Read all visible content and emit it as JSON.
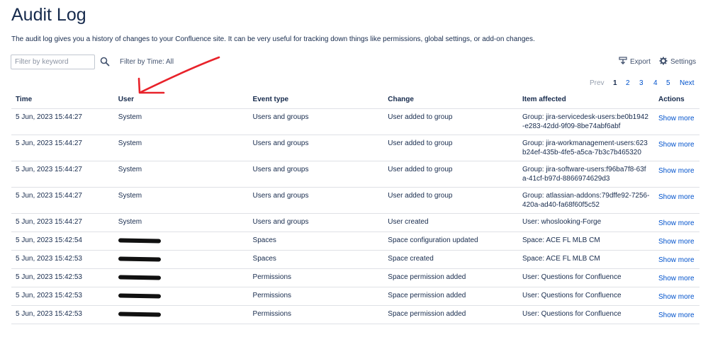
{
  "page": {
    "title": "Audit Log",
    "description": "The audit log gives you a history of changes to your Confluence site. It can be very useful for tracking down things like permissions, global settings, or add-on changes."
  },
  "filters": {
    "keyword_placeholder": "Filter by keyword",
    "keyword_value": "",
    "time_label": "Filter by Time: All"
  },
  "toolbar": {
    "export_label": "Export",
    "settings_label": "Settings"
  },
  "pagination": {
    "prev": "Prev",
    "pages": [
      "1",
      "2",
      "3",
      "4",
      "5"
    ],
    "current": "1",
    "next": "Next"
  },
  "table": {
    "headers": [
      "Time",
      "User",
      "Event type",
      "Change",
      "Item affected",
      "Actions"
    ],
    "rows": [
      {
        "time": "5 Jun, 2023 15:44:27",
        "user": "System",
        "event": "Users and groups",
        "change": "User added to group",
        "item": "Group: jira-servicedesk-users:be0b1942-e283-42dd-9f09-8be74abf6abf",
        "action": "Show more"
      },
      {
        "time": "5 Jun, 2023 15:44:27",
        "user": "System",
        "event": "Users and groups",
        "change": "User added to group",
        "item": "Group: jira-workmanagement-users:623b24ef-435b-4fe5-a5ca-7b3c7b465320",
        "action": "Show more"
      },
      {
        "time": "5 Jun, 2023 15:44:27",
        "user": "System",
        "event": "Users and groups",
        "change": "User added to group",
        "item": "Group: jira-software-users:f96ba7f8-63fa-41cf-b97d-8866974629d3",
        "action": "Show more"
      },
      {
        "time": "5 Jun, 2023 15:44:27",
        "user": "System",
        "event": "Users and groups",
        "change": "User added to group",
        "item": "Group: atlassian-addons:79dffe92-7256-420a-ad40-fa68f60f5c52",
        "action": "Show more"
      },
      {
        "time": "5 Jun, 2023 15:44:27",
        "user": "System",
        "event": "Users and groups",
        "change": "User created",
        "item": "User: whoslooking-Forge",
        "action": "Show more"
      },
      {
        "time": "5 Jun, 2023 15:42:54",
        "user": "",
        "event": "Spaces",
        "change": "Space configuration updated",
        "item": "Space: ACE FL MLB CM",
        "action": "Show more"
      },
      {
        "time": "5 Jun, 2023 15:42:53",
        "user": "",
        "event": "Spaces",
        "change": "Space created",
        "item": "Space: ACE FL MLB CM",
        "action": "Show more"
      },
      {
        "time": "5 Jun, 2023 15:42:53",
        "user": "",
        "event": "Permissions",
        "change": "Space permission added",
        "item": "User: Questions for Confluence",
        "action": "Show more"
      },
      {
        "time": "5 Jun, 2023 15:42:53",
        "user": "",
        "event": "Permissions",
        "change": "Space permission added",
        "item": "User: Questions for Confluence",
        "action": "Show more"
      },
      {
        "time": "5 Jun, 2023 15:42:53",
        "user": "",
        "event": "Permissions",
        "change": "Space permission added",
        "item": "User: Questions for Confluence",
        "action": "Show more"
      }
    ]
  },
  "annotation": {
    "color": "#e8222a",
    "icon": "red-arrow-annotation"
  }
}
